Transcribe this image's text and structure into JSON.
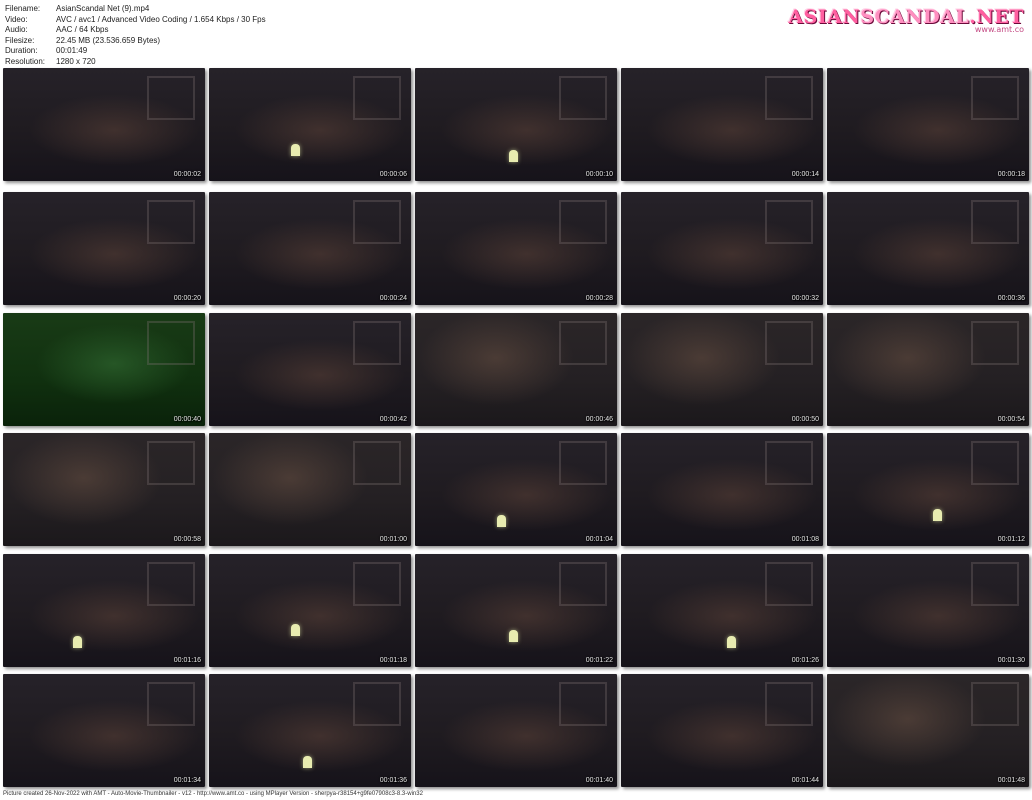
{
  "info": [
    {
      "label": "Filename:",
      "value": "AsianScandal Net (9).mp4"
    },
    {
      "label": "Video:",
      "value": "AVC / avc1 / Advanced Video Coding / 1.654 Kbps / 30 Fps"
    },
    {
      "label": "Audio:",
      "value": "AAC / 64 Kbps"
    },
    {
      "label": "Filesize:",
      "value": "22.45 MB (23.536.659 Bytes)"
    },
    {
      "label": "Duration:",
      "value": "00:01:49"
    },
    {
      "label": "Resolution:",
      "value": "1280 x 720"
    }
  ],
  "logo": {
    "part1": "ASIAN",
    "part2": "SCANDAL",
    "part3": ".NET",
    "sub": "www.amt.co"
  },
  "thumbnails": [
    {
      "time": "00:00:02",
      "style": "dark",
      "glow": false
    },
    {
      "time": "00:00:06",
      "style": "dark",
      "glow": true
    },
    {
      "time": "00:00:10",
      "style": "dark",
      "glow": true
    },
    {
      "time": "00:00:14",
      "style": "dark",
      "glow": false
    },
    {
      "time": "00:00:18",
      "style": "dark",
      "glow": false
    },
    {
      "time": "00:00:20",
      "style": "dark",
      "glow": false
    },
    {
      "time": "00:00:24",
      "style": "dark",
      "glow": false
    },
    {
      "time": "00:00:28",
      "style": "dark",
      "glow": false
    },
    {
      "time": "00:00:32",
      "style": "dark",
      "glow": false
    },
    {
      "time": "00:00:36",
      "style": "dark",
      "glow": false
    },
    {
      "time": "00:00:40",
      "style": "green",
      "glow": false
    },
    {
      "time": "00:00:42",
      "style": "dark",
      "glow": false
    },
    {
      "time": "00:00:46",
      "style": "lighter",
      "glow": false
    },
    {
      "time": "00:00:50",
      "style": "lighter",
      "glow": false
    },
    {
      "time": "00:00:54",
      "style": "lighter",
      "glow": false
    },
    {
      "time": "00:00:58",
      "style": "lighter",
      "glow": false
    },
    {
      "time": "00:01:00",
      "style": "lighter",
      "glow": false
    },
    {
      "time": "00:01:04",
      "style": "dark",
      "glow": true
    },
    {
      "time": "00:01:08",
      "style": "dark",
      "glow": false
    },
    {
      "time": "00:01:12",
      "style": "dark",
      "glow": true
    },
    {
      "time": "00:01:16",
      "style": "dark",
      "glow": true
    },
    {
      "time": "00:01:18",
      "style": "dark",
      "glow": true
    },
    {
      "time": "00:01:22",
      "style": "dark",
      "glow": true
    },
    {
      "time": "00:01:26",
      "style": "dark",
      "glow": true
    },
    {
      "time": "00:01:30",
      "style": "dark",
      "glow": false
    },
    {
      "time": "00:01:34",
      "style": "dark",
      "glow": false
    },
    {
      "time": "00:01:36",
      "style": "dark",
      "glow": true
    },
    {
      "time": "00:01:40",
      "style": "dark",
      "glow": false
    },
    {
      "time": "00:01:44",
      "style": "dark",
      "glow": false
    },
    {
      "time": "00:01:48",
      "style": "lighter",
      "glow": false
    }
  ],
  "footer": "Picture created 26-Nov-2022 with AMT - Auto-Movie-Thumbnailer - v12 - http://www.amt.co - using MPlayer Version - sherpya-r38154+g9fe07908c3-8.3-win32"
}
